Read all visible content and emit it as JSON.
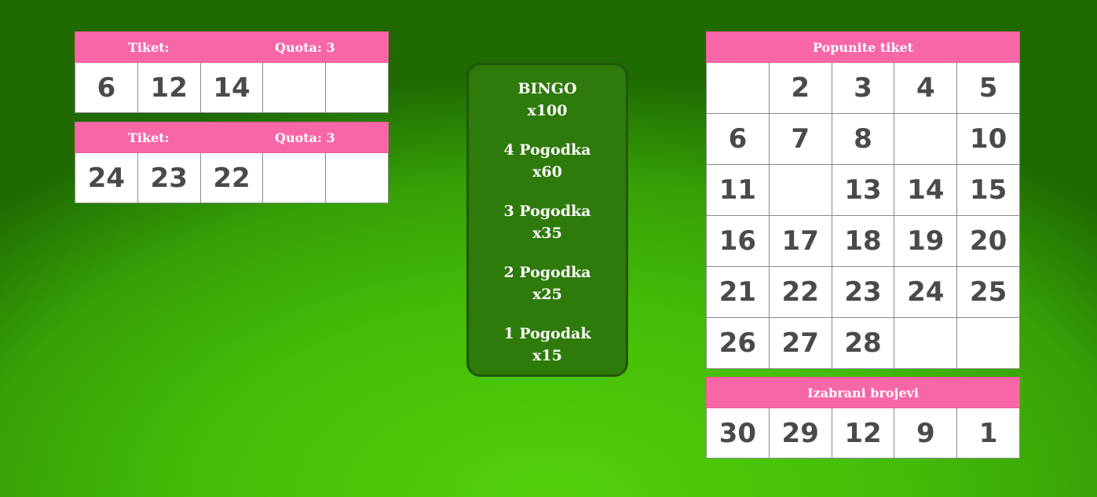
{
  "tickets": [
    {
      "label": "Tiket:",
      "quota": "Quota: 3",
      "numbers": [
        "6",
        "12",
        "14",
        "",
        ""
      ]
    },
    {
      "label": "Tiket:",
      "quota": "Quota: 3",
      "numbers": [
        "24",
        "23",
        "22",
        "",
        ""
      ]
    }
  ],
  "prizes": [
    {
      "name": "BINGO",
      "mult": "x100"
    },
    {
      "name": "4 Pogodka",
      "mult": "x60"
    },
    {
      "name": "3 Pogodka",
      "mult": "x35"
    },
    {
      "name": "2 Pogodka",
      "mult": "x25"
    },
    {
      "name": "1 Pogodak",
      "mult": "x15"
    }
  ],
  "fill_ticket": {
    "title": "Popunite tiket",
    "numbers": [
      "",
      "2",
      "3",
      "4",
      "5",
      "6",
      "7",
      "8",
      "",
      "10",
      "11",
      "",
      "13",
      "14",
      "15",
      "16",
      "17",
      "18",
      "19",
      "20",
      "21",
      "22",
      "23",
      "24",
      "25",
      "26",
      "27",
      "28",
      "",
      ""
    ]
  },
  "chosen_numbers": {
    "title": "Izabrani brojevi",
    "numbers": [
      "30",
      "29",
      "12",
      "9",
      "1"
    ]
  }
}
